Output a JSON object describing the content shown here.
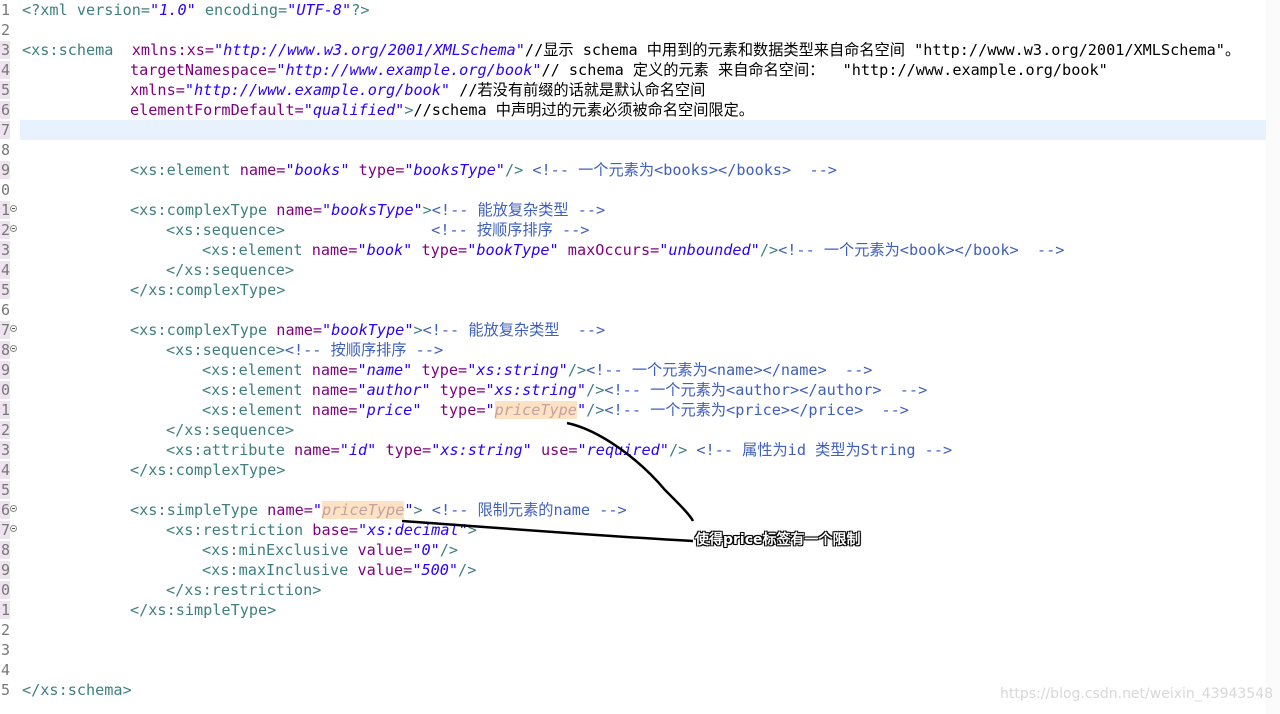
{
  "line_numbers": [
    "1",
    "2",
    "3",
    "4",
    "5",
    "6",
    "7",
    "8",
    "9",
    "0",
    "1",
    "2",
    "3",
    "4",
    "5",
    "6",
    "7",
    "8",
    "9",
    "0",
    "1",
    "2",
    "3",
    "4",
    "5",
    "6",
    "7",
    "8",
    "9",
    "0",
    "1",
    "2",
    "3",
    "4",
    "5"
  ],
  "code": {
    "l1": {
      "p1": "<?xml version=",
      "v1": "\"1.0\"",
      "p2": " encoding=",
      "v2": "\"UTF-8\"",
      "p3": "?>"
    },
    "l3": {
      "t1": "<xs:schema",
      "a1": "  xmlns:xs=",
      "v1": "\"http://www.w3.org/2001/XMLSchema\"",
      "c1": "//显示 schema 中用到的元素和数据类型来自命名空间 \"http://www.w3.org/2001/XMLSchema\"。"
    },
    "l4": {
      "a1": "targetNamespace=",
      "v1": "\"http://www.example.org/book\"",
      "c1": "// schema 定义的元素 来自命名空间：  \"http://www.example.org/book\""
    },
    "l5": {
      "a1": "xmlns=",
      "v1": "\"http://www.example.org/book\"",
      "c1": " //若没有前缀的话就是默认命名空间"
    },
    "l6": {
      "a1": "elementFormDefault=",
      "v1": "\"qualified\"",
      "t1": ">",
      "c1": "//schema 中声明过的元素必须被命名空间限定。"
    },
    "l9": {
      "t1": "<xs:element",
      "a1": " name=",
      "v1": "\"books\"",
      "a2": " type=",
      "v2": "\"booksType\"",
      "t2": "/>",
      "c1": " <!-- 一个元素为<books></books>  -->"
    },
    "l11": {
      "t1": "<xs:complexType",
      "a1": " name=",
      "v1": "\"booksType\"",
      "t2": ">",
      "c1": "<!-- 能放复杂类型 -->"
    },
    "l12": {
      "t1": "<xs:sequence>",
      "c1": "                <!-- 按顺序排序 -->"
    },
    "l13": {
      "t1": "<xs:element",
      "a1": " name=",
      "v1": "\"book\"",
      "a2": " type=",
      "v2": "\"bookType\"",
      "a3": " maxOccurs=",
      "v3": "\"unbounded\"",
      "t2": "/>",
      "c1": "<!-- 一个元素为<book></book>  -->"
    },
    "l14": {
      "t1": "</xs:sequence>"
    },
    "l15": {
      "t1": "</xs:complexType>"
    },
    "l17": {
      "t1": "<xs:complexType",
      "a1": " name=",
      "v1": "\"bookType\"",
      "t2": ">",
      "c1": "<!-- 能放复杂类型  -->"
    },
    "l18": {
      "t1": "<xs:sequence>",
      "c1": "<!-- 按顺序排序 -->"
    },
    "l19": {
      "t1": "<xs:element",
      "a1": " name=",
      "v1": "\"name\"",
      "a2": " type=",
      "v2": "\"xs:string\"",
      "t2": "/>",
      "c1": "<!-- 一个元素为<name></name>  -->"
    },
    "l20": {
      "t1": "<xs:element",
      "a1": " name=",
      "v1": "\"author\"",
      "a2": " type=",
      "v2": "\"xs:string\"",
      "t2": "/>",
      "c1": "<!-- 一个元素为<author></author>  -->"
    },
    "l21": {
      "t1": "<xs:element",
      "a1": " name=",
      "v1": "\"price\"",
      "a2": "  type=",
      "q1": "\"",
      "h1": "priceType",
      "q2": "\"",
      "t2": "/>",
      "c1": "<!-- 一个元素为<price></price>  -->"
    },
    "l22": {
      "t1": "</xs:sequence>"
    },
    "l23": {
      "t1": "<xs:attribute",
      "a1": " name=",
      "v1": "\"id\"",
      "a2": " type=",
      "v2": "\"xs:string\"",
      "a3": " use=",
      "v3": "\"required\"",
      "t2": "/>",
      "c1": " <!-- 属性为id 类型为String -->"
    },
    "l24": {
      "t1": "</xs:complexType>"
    },
    "l26": {
      "t1": "<xs:simpleType",
      "a1": " name=",
      "q1": "\"",
      "h1": "priceType",
      "q2": "\"",
      "t2": ">",
      "c1": " <!-- 限制元素的name -->"
    },
    "l27": {
      "t1": "<xs:restriction",
      "a1": " base=",
      "v1": "\"xs:decimal\"",
      "t2": ">"
    },
    "l28": {
      "t1": "<xs:minExclusive",
      "a1": " value=",
      "v1": "\"0\"",
      "t2": "/>"
    },
    "l29": {
      "t1": "<xs:maxInclusive",
      "a1": " value=",
      "v1": "\"500\"",
      "t2": "/>"
    },
    "l30": {
      "t1": "</xs:restriction>"
    },
    "l31": {
      "t1": "</xs:simpleType>"
    },
    "l35": {
      "t1": "</xs:schema>"
    }
  },
  "annotation": {
    "label": "使得price标签有一个限制"
  },
  "watermark": "https://blog.csdn.net/weixin_43943548",
  "colors": {
    "tag": "#3f7f7f",
    "attribute": "#7f007f",
    "value": "#2a00ff",
    "comment": "#3f5fbf",
    "current_line": "#e8f2fe",
    "highlight": "#fde2c4"
  }
}
